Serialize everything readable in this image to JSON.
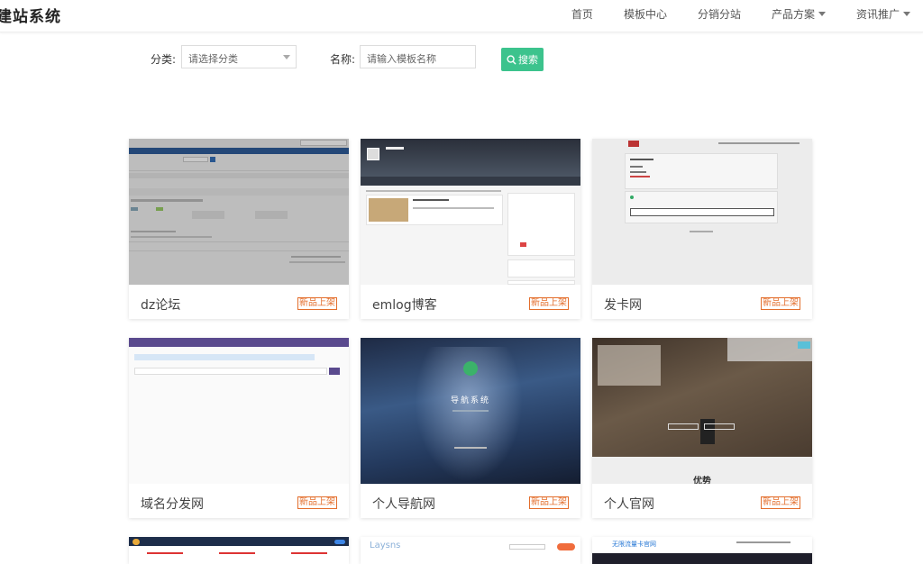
{
  "header": {
    "brand": "建站系统",
    "nav": [
      {
        "label": "首页",
        "dropdown": false
      },
      {
        "label": "模板中心",
        "dropdown": false
      },
      {
        "label": "分销分站",
        "dropdown": false
      },
      {
        "label": "产品方案",
        "dropdown": true
      },
      {
        "label": "资讯推广",
        "dropdown": true
      }
    ]
  },
  "filter": {
    "category_label": "分类:",
    "category_placeholder": "请选择分类",
    "name_label": "名称:",
    "name_placeholder": "请输入模板名称",
    "search_label": "搜索"
  },
  "templates": [
    {
      "name": "dz论坛",
      "badge": "新品上架"
    },
    {
      "name": "emlog博客",
      "badge": "新品上架"
    },
    {
      "name": "发卡网",
      "badge": "新品上架"
    },
    {
      "name": "域名分发网",
      "badge": "新品上架"
    },
    {
      "name": "个人导航网",
      "badge": "新品上架",
      "thumb_title": "导航系统"
    },
    {
      "name": "个人官网",
      "badge": "新品上架",
      "thumb_caption": "优势"
    }
  ],
  "partial_thumbs": {
    "second": "Laysns",
    "third": "无限流量卡官网"
  },
  "colors": {
    "accent": "#3cc38d",
    "badge": "#e36e2c"
  }
}
